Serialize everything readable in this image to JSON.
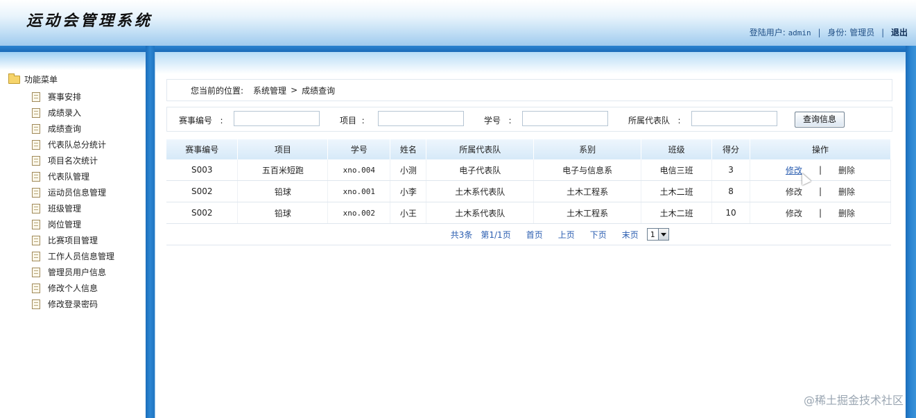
{
  "header": {
    "title": "运动会管理系统",
    "user_label": "登陆用户:",
    "user_name": "admin",
    "role_label": "身份:",
    "role_value": "管理员",
    "logout": "退出"
  },
  "sidebar": {
    "root_label": "功能菜单",
    "items": [
      {
        "label": "赛事安排"
      },
      {
        "label": "成绩录入"
      },
      {
        "label": "成绩查询"
      },
      {
        "label": "代表队总分统计"
      },
      {
        "label": "项目名次统计"
      },
      {
        "label": "代表队管理"
      },
      {
        "label": "运动员信息管理"
      },
      {
        "label": "班级管理"
      },
      {
        "label": "岗位管理"
      },
      {
        "label": "比赛项目管理"
      },
      {
        "label": "工作人员信息管理"
      },
      {
        "label": "管理员用户信息"
      },
      {
        "label": "修改个人信息"
      },
      {
        "label": "修改登录密码"
      }
    ]
  },
  "breadcrumb": {
    "lead": "您当前的位置:",
    "level1": "系统管理",
    "arrow": ">",
    "level2": "成绩查询"
  },
  "search": {
    "fields": [
      {
        "label": "赛事编号",
        "colon": ":",
        "value": ""
      },
      {
        "label": "项目",
        "colon": ":",
        "value": ""
      },
      {
        "label": "学号",
        "colon": ":",
        "value": ""
      },
      {
        "label": "所属代表队",
        "colon": ":",
        "value": ""
      }
    ],
    "button": "查询信息"
  },
  "table": {
    "headers": [
      "赛事编号",
      "项目",
      "学号",
      "姓名",
      "所属代表队",
      "系别",
      "班级",
      "得分",
      "操作"
    ],
    "rows": [
      {
        "event_id": "S003",
        "item": "五百米短跑",
        "student_id": "xno.004",
        "name": "小测",
        "team": "电子代表队",
        "dept": "电子与信息系",
        "class": "电信三班",
        "score": "3",
        "edit": "修改",
        "sep": "|",
        "delete": "删除"
      },
      {
        "event_id": "S002",
        "item": "铅球",
        "student_id": "xno.001",
        "name": "小李",
        "team": "土木系代表队",
        "dept": "土木工程系",
        "class": "土木二班",
        "score": "8",
        "edit": "修改",
        "sep": "|",
        "delete": "删除"
      },
      {
        "event_id": "S002",
        "item": "铅球",
        "student_id": "xno.002",
        "name": "小王",
        "team": "土木系代表队",
        "dept": "土木工程系",
        "class": "土木二班",
        "score": "10",
        "edit": "修改",
        "sep": "|",
        "delete": "删除"
      }
    ]
  },
  "pager": {
    "total": "共3条",
    "page_info": "第1/1页",
    "first": "首页",
    "prev": "上页",
    "next": "下页",
    "last": "末页",
    "current_page": "1"
  },
  "watermark": "@稀土掘金技术社区"
}
